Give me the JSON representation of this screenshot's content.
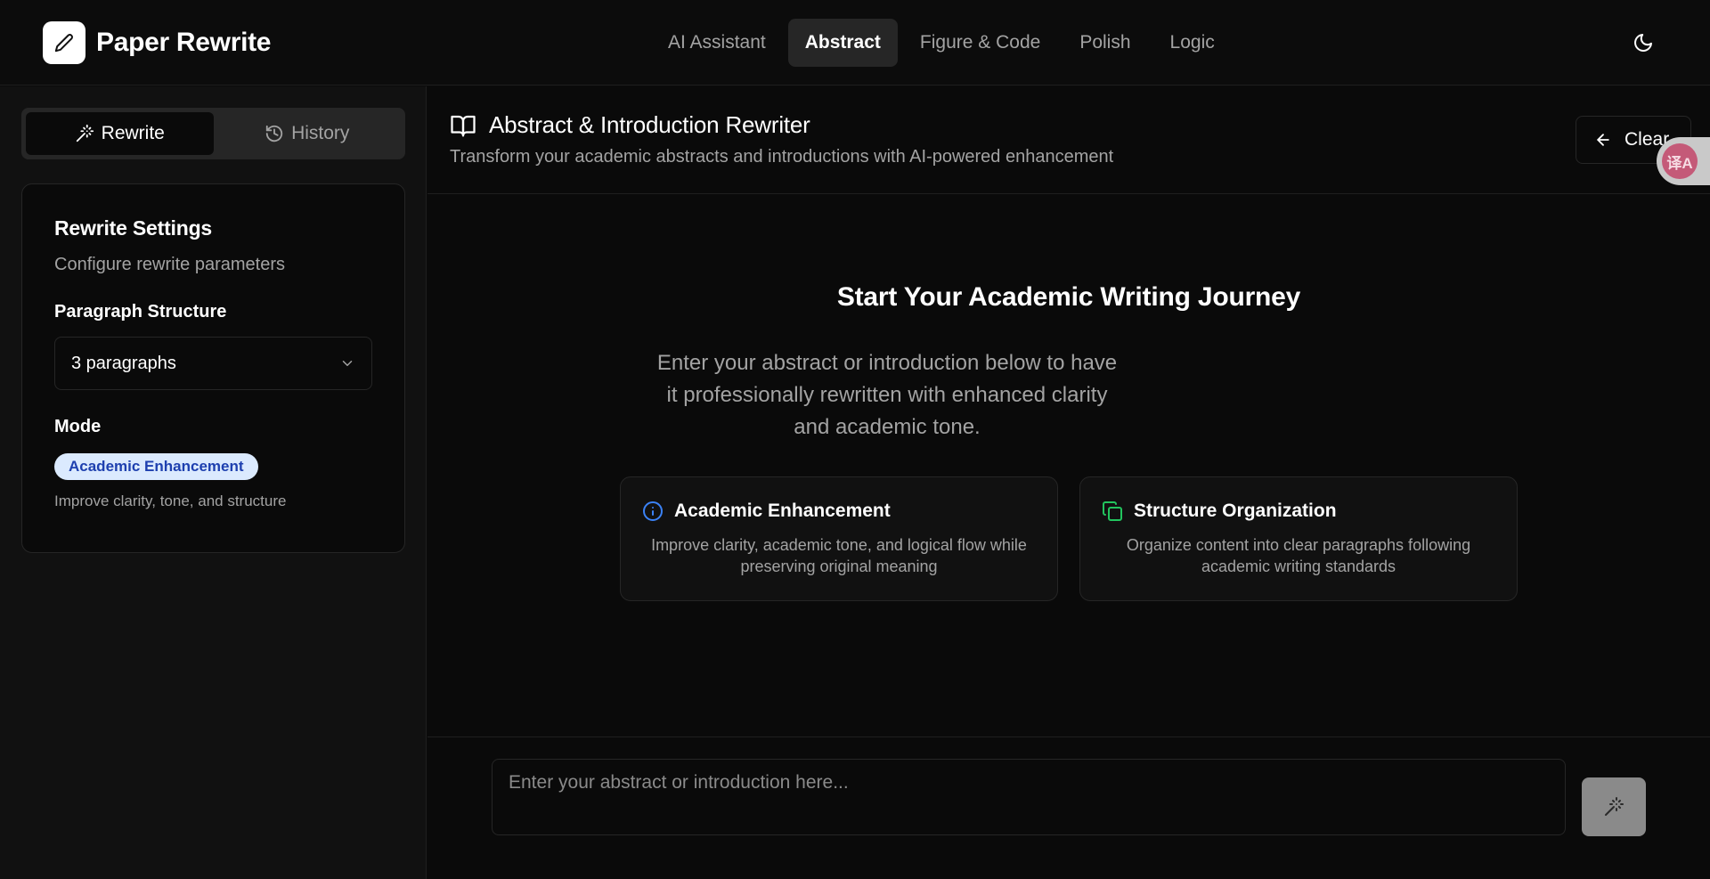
{
  "brand": {
    "name": "Paper Rewrite",
    "logo_icon": "pencil-icon"
  },
  "nav": {
    "items": [
      {
        "label": "AI Assistant",
        "active": false
      },
      {
        "label": "Abstract",
        "active": true
      },
      {
        "label": "Figure & Code",
        "active": false
      },
      {
        "label": "Polish",
        "active": false
      },
      {
        "label": "Logic",
        "active": false
      }
    ],
    "theme_icon": "moon-icon"
  },
  "sidebar": {
    "tabs": [
      {
        "label": "Rewrite",
        "icon": "magic-wand-icon",
        "active": true
      },
      {
        "label": "History",
        "icon": "history-icon",
        "active": false
      }
    ],
    "settings": {
      "title": "Rewrite Settings",
      "subtitle": "Configure rewrite parameters",
      "paragraph_label": "Paragraph Structure",
      "paragraph_value": "3 paragraphs",
      "mode_label": "Mode",
      "mode_badge": "Academic Enhancement",
      "mode_desc": "Improve clarity, tone, and structure"
    }
  },
  "main": {
    "title": "Abstract & Introduction Rewriter",
    "subtitle": "Transform your academic abstracts and introductions with AI-powered enhancement",
    "clear_label": "Clear",
    "hero_title": "Start Your Academic Writing Journey",
    "hero_text": "Enter your abstract or introduction below to have it professionally rewritten with enhanced clarity and academic tone.",
    "features": [
      {
        "title": "Academic Enhancement",
        "desc": "Improve clarity, academic tone, and logical flow while preserving original meaning",
        "icon": "info-icon",
        "color": "#3b82f6"
      },
      {
        "title": "Structure Organization",
        "desc": "Organize content into clear paragraphs following academic writing standards",
        "icon": "copy-icon",
        "color": "#22c55e"
      }
    ],
    "input_placeholder": "Enter your abstract or introduction here..."
  },
  "translate_fab": {
    "label": "译A"
  }
}
